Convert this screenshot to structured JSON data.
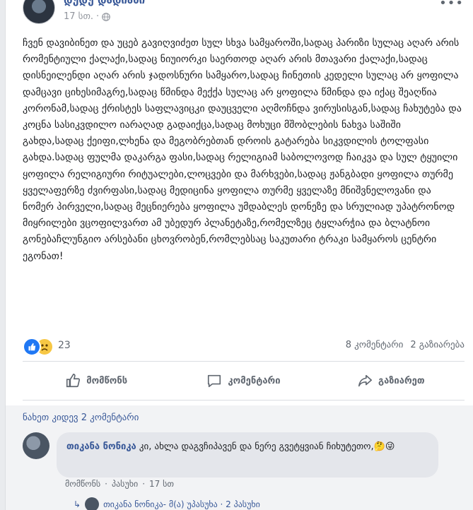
{
  "post": {
    "author": "დუდუ დადიანი",
    "time": "17 სთ.",
    "text": "ჩვენ დავიბინეთ და უცებ გავიღვიძეთ სულ სხვა სამყაროში,სადაც პარიზი სულაც აღარ არის რომენტიული ქალაქი,სადაც ნიუიორკი საერთოდ აღარ არის მთავარი ქალაქი,სადაც დისნეილენდი აღარ არის ჯადოსნური სამყარო,სადაც ჩინეთის კედელი სულაც არ ყოფილა დამცავი ციხესიმაგრე,სადაც წმინდა მექქა სულაც არ ყოფილა წმინდა და იქაც შეაღწია კორონამ,სადაც ქრისტეს საფლავიცკი დაუცველი აღმოჩნდა ვირუსისგან,სადაც ჩახუტება და კოცნა სასიკვდილო იარაღად გადაიქცა,სადაც მოხუცი მშობლების ნახვა საშიში გახდა,სადაც ქეიფი,ლხენა და მეგობრებთან დროის გატარება სიკვდილის ტოლფასი გახდა.სადაც ფულმა დაკარგა ფასი,სადაც რელიგიამ საბოლოვოდ ჩაიკვა და სულ ტყუილი ყოფილა რელიგიური რიტუალები,ლოცვები და მარხვები,სადაც ჟანგბადი ყოფილა თურმე ყველაფერზე ძვირფასი,სადაც მედიცინა ყოფილა თურმე ყველაზე მნიშვნელოვანი და ნომერ პირველი,სადაც მეცნიერება ყოფილა უმდაბლეს დონეზე და სრულიად უპატრონოდ მიყრილები ვცოფილვართ ამ უბედურ პლანეტაზე,რომელზეც ტყლარჭია და ბლატნოი გონებაჩლუნგიო არსებანი ცხოვრობენ,რომლებსაც საკუთარი ტრაკი სამყაროს ცენტრი ეგონათ!",
    "more_icon": "more-dots-icon",
    "privacy_icon": "globe-icon"
  },
  "reactions": {
    "count": "23",
    "comments": "8 კომენტარი",
    "shares": "2 გაზიარება"
  },
  "actions": {
    "like": "მომწონს",
    "comment": "კომენტარი",
    "share": "გაზიარეთ"
  },
  "comments": {
    "view_more": "ნახეთ კიდევ 2 კომენტარი",
    "items": [
      {
        "author": "თიკანა ნონიკა",
        "text": " კი, ახლა დაგვჩიპავენ და ნერე გვეტყვიან ჩიხუტეთო,",
        "emoji": "🤔😜",
        "like": "მომწონს",
        "reply": "პასუხი",
        "time": "17 სთ"
      }
    ],
    "reply_preview": "თიკანა ნონიკა- მ(ა) უპასუხა · 2 პასუხი"
  },
  "colors": {
    "link": "#385898",
    "like_blue": "#2078f4",
    "muted": "#606770"
  }
}
